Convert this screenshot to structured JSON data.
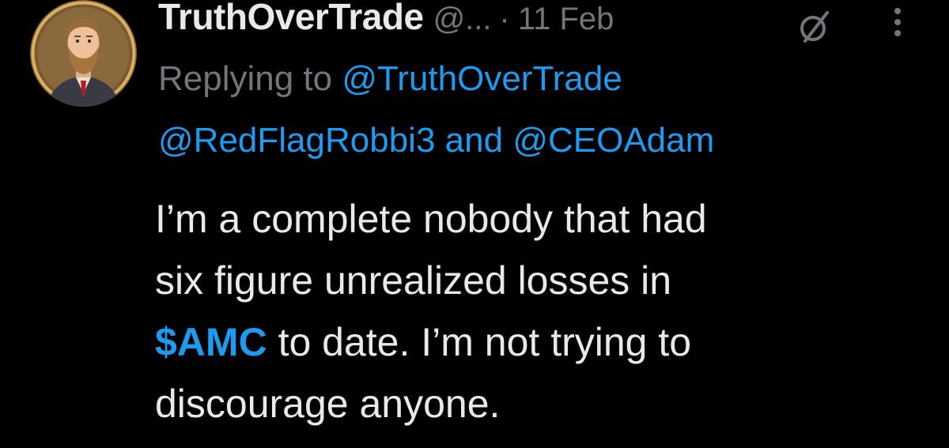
{
  "tweet": {
    "display_name": "TruthOverTrade",
    "handle": "@...",
    "separator": "·",
    "date": "11 Feb",
    "edited_icon": "edited-icon",
    "more_icon": "more-vertical-icon",
    "reply": {
      "prefix": "Replying to",
      "mention_1": "@TruthOverTrade",
      "mention_2": "@RedFlagRobbi3",
      "conjunction": "and",
      "mention_3": "@CEOAdam"
    },
    "body": {
      "line_1": "I’m a complete nobody that had",
      "line_2": "six figure unrealized losses in",
      "cashtag": "$AMC",
      "line_3_rest": " to date. I’m not trying to",
      "line_4": "discourage anyone."
    }
  },
  "colors": {
    "background": "#000000",
    "text": "#e7e9ea",
    "muted": "#71767b",
    "link": "#1d9bf0"
  }
}
